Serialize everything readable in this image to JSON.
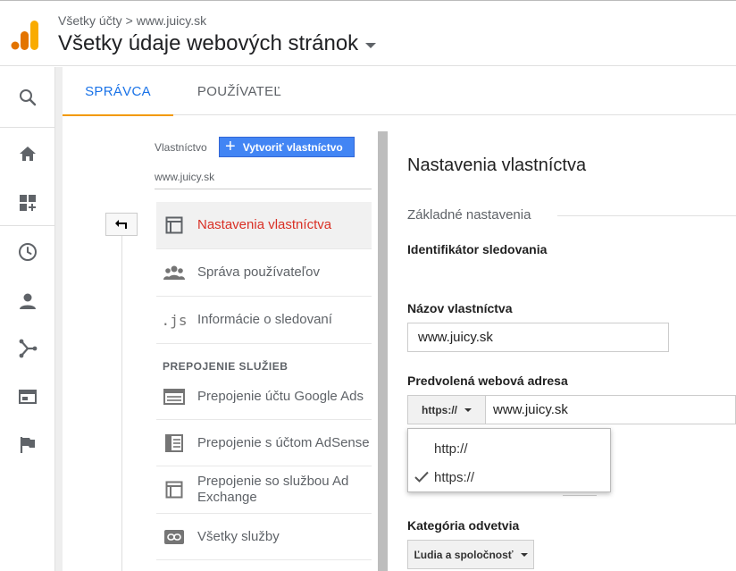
{
  "header": {
    "breadcrumb_account": "Všetky účty",
    "breadcrumb_sep": ">",
    "breadcrumb_property": "www.juicy.sk",
    "title": "Všetky údaje webových stránok"
  },
  "rail": {
    "icons": [
      "search-icon",
      "home-icon",
      "customization-icon",
      "realtime-icon",
      "audience-icon",
      "acquisition-icon",
      "behavior-icon",
      "conversions-icon"
    ]
  },
  "tabs": [
    {
      "label": "SPRÁVCA",
      "active": true
    },
    {
      "label": "POUŽÍVATEĽ",
      "active": false
    }
  ],
  "admin": {
    "property_label": "Vlastníctvo",
    "create_button": "Vytvoriť vlastníctvo",
    "property_name": "www.juicy.sk",
    "menu": [
      {
        "label": "Nastavenia vlastníctva",
        "icon": "property-settings-icon",
        "active": true
      },
      {
        "label": "Správa používateľov",
        "icon": "users-icon",
        "active": false
      },
      {
        "label": "Informácie o sledovaní",
        "icon": "js-icon",
        "active": false
      }
    ],
    "section_label": "PREPOJENIE SLUŽIEB",
    "services": [
      {
        "label": "Prepojenie účtu Google Ads",
        "icon": "google-ads-icon"
      },
      {
        "label": "Prepojenie s účtom AdSense",
        "icon": "adsense-icon"
      },
      {
        "label": "Prepojenie so službou Ad Exchange",
        "icon": "ad-exchange-icon"
      },
      {
        "label": "Všetky služby",
        "icon": "link-icon"
      }
    ]
  },
  "settings": {
    "title": "Nastavenia vlastníctva",
    "basic_section": "Základné nastavenia",
    "tracking_id_label": "Identifikátor sledovania",
    "property_name_label": "Názov vlastníctva",
    "property_name_value": "www.juicy.sk",
    "default_url_label": "Predvolená webová adresa",
    "protocol_value": "https://",
    "url_value": "www.juicy.sk",
    "protocol_options": [
      {
        "label": "http://",
        "selected": false
      },
      {
        "label": "https://",
        "selected": true
      }
    ],
    "category_label": "Kategória odvetvia",
    "category_value": "Ľudia a spoločnosť"
  },
  "colors": {
    "accent_blue": "#1a73e8",
    "tab_underline": "#f29900",
    "active_red": "#d93025",
    "button_blue": "#4285f4",
    "logo_orange": "#f9ab00",
    "logo_dark_orange": "#e37400"
  }
}
